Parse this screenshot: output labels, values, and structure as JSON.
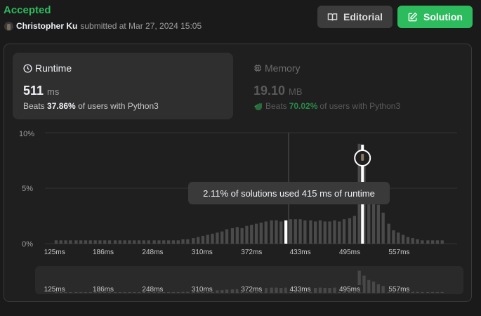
{
  "header": {
    "status": "Accepted",
    "submitter_name": "Christopher Ku",
    "submitted_text": "submitted at Mar 27, 2024 15:05",
    "editorial_label": "Editorial",
    "solution_label": "Solution"
  },
  "runtime": {
    "title": "Runtime",
    "value": "511",
    "unit": "ms",
    "beats_label": "Beats",
    "beats_percent": "37.86%",
    "beats_suffix": "of users with Python3"
  },
  "memory": {
    "title": "Memory",
    "value": "19.10",
    "unit": "MB",
    "beats_label": "Beats",
    "beats_percent": "70.02%",
    "beats_suffix": "of users with Python3"
  },
  "tooltip": "2.11% of solutions used 415 ms of runtime",
  "chart_data": {
    "type": "bar",
    "y_ticks": [
      "10%",
      "5%",
      "0%"
    ],
    "ylim": [
      0,
      10
    ],
    "x_tick_labels": [
      "125ms",
      "186ms",
      "248ms",
      "310ms",
      "372ms",
      "433ms",
      "495ms",
      "557ms"
    ],
    "x_tick_values": [
      125,
      186,
      248,
      310,
      372,
      433,
      495,
      557
    ],
    "xlim": [
      120,
      620
    ],
    "bar_width_ms": 6.15,
    "runtime_ms": [
      127,
      133,
      139,
      145,
      152,
      158,
      164,
      170,
      176,
      182,
      188,
      194,
      201,
      207,
      213,
      219,
      225,
      231,
      237,
      243,
      250,
      256,
      262,
      268,
      274,
      280,
      286,
      292,
      299,
      305,
      311,
      317,
      323,
      329,
      335,
      341,
      348,
      354,
      360,
      366,
      372,
      378,
      384,
      390,
      397,
      403,
      409,
      415,
      421,
      427,
      433,
      439,
      446,
      452,
      458,
      464,
      470,
      476,
      482,
      488,
      495,
      501,
      507,
      513,
      519,
      525,
      531,
      537,
      544,
      550,
      556,
      562,
      568,
      574,
      580,
      586,
      593,
      599,
      605,
      611
    ],
    "percent": [
      0.3,
      0.3,
      0.3,
      0.3,
      0.3,
      0.3,
      0.3,
      0.3,
      0.3,
      0.3,
      0.3,
      0.3,
      0.3,
      0.3,
      0.3,
      0.3,
      0.3,
      0.3,
      0.3,
      0.3,
      0.3,
      0.3,
      0.3,
      0.3,
      0.3,
      0.3,
      0.4,
      0.4,
      0.5,
      0.6,
      0.7,
      0.8,
      0.9,
      1.0,
      1.1,
      1.3,
      1.4,
      1.5,
      1.4,
      1.6,
      1.7,
      1.8,
      1.9,
      2.0,
      2.1,
      2.11,
      2.0,
      2.1,
      2.2,
      2.2,
      2.2,
      2.1,
      2.1,
      2.0,
      2.1,
      2.0,
      2.0,
      2.1,
      2.0,
      2.2,
      2.3,
      2.5,
      9.0,
      7.0,
      5.2,
      4.6,
      3.5,
      2.8,
      1.8,
      1.2,
      1.0,
      0.8,
      0.6,
      0.5,
      0.4,
      0.3,
      0.3,
      0.3,
      0.3,
      0.3
    ],
    "highlight_runtime_ms": 415,
    "highlight_percent": 2.11,
    "your_runtime_ms": 511
  }
}
